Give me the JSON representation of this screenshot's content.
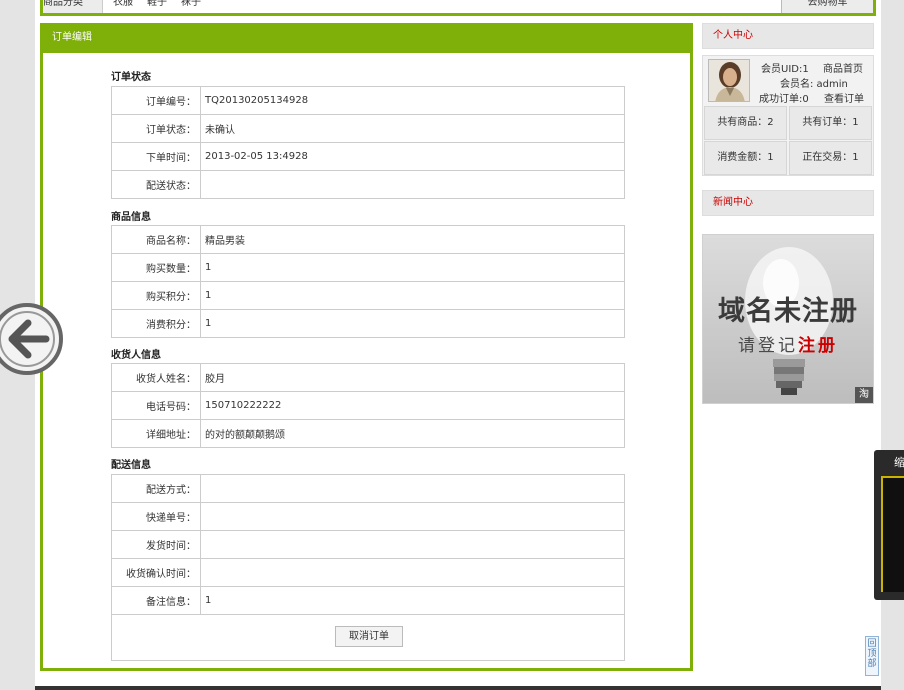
{
  "topnav": {
    "category": "商品分类",
    "links": [
      "衣服",
      "鞋子",
      "袜子"
    ],
    "cart": "去购物车"
  },
  "main": {
    "title": "订单编辑",
    "sections": [
      {
        "title": "订单状态",
        "rows": [
          {
            "label": "订单编号：",
            "value": "TQ20130205134928"
          },
          {
            "label": "订单状态：",
            "value": "未确认"
          },
          {
            "label": "下单时间：",
            "value": "2013-02-05 13:4928"
          },
          {
            "label": "配送状态：",
            "value": ""
          }
        ]
      },
      {
        "title": "商品信息",
        "rows": [
          {
            "label": "商品名称：",
            "value": "精品男装"
          },
          {
            "label": "购买数量：",
            "value": "1"
          },
          {
            "label": "购买积分：",
            "value": "1"
          },
          {
            "label": "消费积分：",
            "value": "1"
          }
        ]
      },
      {
        "title": "收货人信息",
        "rows": [
          {
            "label": "收货人姓名：",
            "value": "胶月"
          },
          {
            "label": "电话号码：",
            "value": "150710222222"
          },
          {
            "label": "详细地址：",
            "value": "的对的额颠颠鹅颂"
          }
        ]
      },
      {
        "title": "配送信息",
        "rows": [
          {
            "label": "配送方式：",
            "value": ""
          },
          {
            "label": "快递单号：",
            "value": ""
          },
          {
            "label": "发货时间：",
            "value": ""
          },
          {
            "label": "收货确认时间：",
            "value": ""
          },
          {
            "label": "备注信息：",
            "value": "1"
          }
        ]
      }
    ],
    "cancel_label": "取消订单"
  },
  "sidebar": {
    "personal_title": "个人中心",
    "uid": "会员UID:1",
    "home_link": "商品首页",
    "username": "会员名: admin",
    "success_orders": "成功订单:0",
    "view_orders": "查看订单",
    "stats": [
      "共有商品：2",
      "共有订单：1",
      "消费金额：1",
      "正在交易：1"
    ],
    "news_title": "新闻中心",
    "ad": {
      "line1": "域名未注册",
      "line2_prefix": "请登记",
      "line2_highlight": "注册",
      "tag": "淘"
    }
  },
  "floating": {
    "box_title": "缩",
    "to_top": "回顶部"
  },
  "colors": {
    "accent": "#7fb00a",
    "highlight": "#cc0000"
  }
}
